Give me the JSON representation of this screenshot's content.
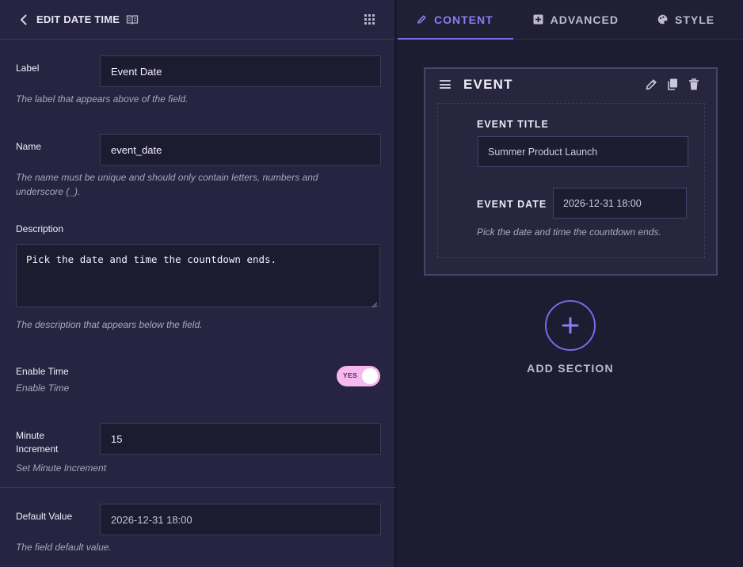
{
  "header": {
    "title": "EDIT DATE TIME"
  },
  "fields": {
    "label": {
      "label": "Label",
      "value": "Event Date",
      "hint": "The label that appears above of the field."
    },
    "name": {
      "label": "Name",
      "value": "event_date",
      "hint_line1": "The name must be unique and should only contain letters, numbers and",
      "hint_line2": "underscore (_)."
    },
    "description": {
      "label": "Description",
      "value": "Pick the date and time the countdown ends.",
      "hint": "The description that appears below the field."
    },
    "enable_time": {
      "label": "Enable Time",
      "hint": "Enable Time",
      "toggle_text": "YES",
      "enabled": true
    },
    "minute_increment": {
      "label_line1": "Minute",
      "label_line2": "Increment",
      "value": "15",
      "hint": "Set Minute Increment"
    },
    "default_value": {
      "label": "Default Value",
      "value": "2026-12-31 18:00",
      "hint": "The field default value."
    }
  },
  "tabs": [
    {
      "label": "CONTENT",
      "icon": "pencil-icon",
      "active": true
    },
    {
      "label": "ADVANCED",
      "icon": "plus-square-icon",
      "active": false
    },
    {
      "label": "STYLE",
      "icon": "palette-icon",
      "active": false
    }
  ],
  "section": {
    "title": "EVENT",
    "event_title_label": "EVENT TITLE",
    "event_title_value": "Summer Product Launch",
    "event_date_label": "EVENT DATE",
    "event_date_value": "2026-12-31 18:00",
    "event_date_hint": "Pick the date and time the countdown ends."
  },
  "add_section": {
    "label": "ADD SECTION"
  },
  "colors": {
    "accent": "#7b68ee",
    "toggle_on": "#f6b8ee",
    "panel": "#262440",
    "canvas": "#1d1c30"
  }
}
